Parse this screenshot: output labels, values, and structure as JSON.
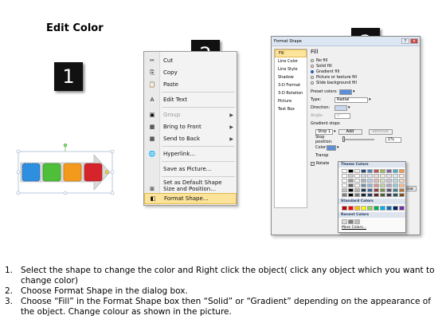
{
  "title": "Edit Color",
  "steps": [
    "1",
    "2",
    "3"
  ],
  "context_menu": {
    "items": [
      {
        "icon": "cut-icon",
        "label": "Cut"
      },
      {
        "icon": "copy-icon",
        "label": "Copy"
      },
      {
        "icon": "paste-icon",
        "label": "Paste"
      },
      {
        "icon": "edit-text-icon",
        "label": "Edit Text"
      },
      {
        "icon": "group-icon",
        "label": "Group"
      },
      {
        "icon": "bring-to-front-icon",
        "label": "Bring to Front"
      },
      {
        "icon": "send-to-back-icon",
        "label": "Send to Back"
      },
      {
        "icon": "hyperlink-icon",
        "label": "Hyperlink..."
      },
      {
        "icon": "",
        "label": "Save as Picture..."
      },
      {
        "icon": "",
        "label": "Set as Default Shape"
      },
      {
        "icon": "size-icon",
        "label": "Size and Position..."
      },
      {
        "icon": "format-shape-icon",
        "label": "Format Shape..."
      }
    ]
  },
  "dialog": {
    "title": "Format Shape",
    "categories": [
      "Fill",
      "Line Color",
      "Line Style",
      "Shadow",
      "3-D Format",
      "3-D Rotation",
      "Picture",
      "Text Box"
    ],
    "fill_header": "Fill",
    "fill_options": [
      "No fill",
      "Solid fill",
      "Gradient fill",
      "Picture or texture fill",
      "Slide background fill"
    ],
    "preset_colors_label": "Preset colors:",
    "type_label": "Type:",
    "type_value": "Radial",
    "direction_label": "Direction:",
    "angle_label": "Angle:",
    "angle_value": "0°",
    "gradient_stops_label": "Gradient stops",
    "stop_value": "Stop 1",
    "add_label": "Add",
    "remove_label": "Remove",
    "stop_position_label": "Stop position:",
    "stop_position_value": "1%",
    "color_label": "Color:",
    "transparency_label": "Transp",
    "rotate_label": "Rotate",
    "close_label": "ose"
  },
  "palette": {
    "theme_label": "Theme Colors",
    "standard_label": "Standard Colors",
    "recent_label": "Recent Colors",
    "more_label": "More Colors...",
    "theme_top": [
      "#ffffff",
      "#000000",
      "#eeece1",
      "#1f497d",
      "#4f81bd",
      "#c0504d",
      "#9bbb59",
      "#8064a2",
      "#4bacc6",
      "#f79646"
    ],
    "standard": [
      "#c00000",
      "#ff0000",
      "#ffc000",
      "#ffff00",
      "#92d050",
      "#00b050",
      "#00b0f0",
      "#0070c0",
      "#002060",
      "#7030a0"
    ],
    "recent": [
      "#d9d9d9",
      "#7f7f7f",
      "#bfbfbf"
    ]
  },
  "instructions": [
    {
      "num": "1.",
      "text": "Select the shape to change the color and Right click the object( click any object which you want to change color)"
    },
    {
      "num": "2.",
      "text": "Choose Format Shape in the dialog box."
    },
    {
      "num": "3.",
      "text": "Choose “Fill” in the Format Shape box then “Solid” or “Gradient” depending on the appearance of the object. Change colour as shown in the picture."
    }
  ]
}
